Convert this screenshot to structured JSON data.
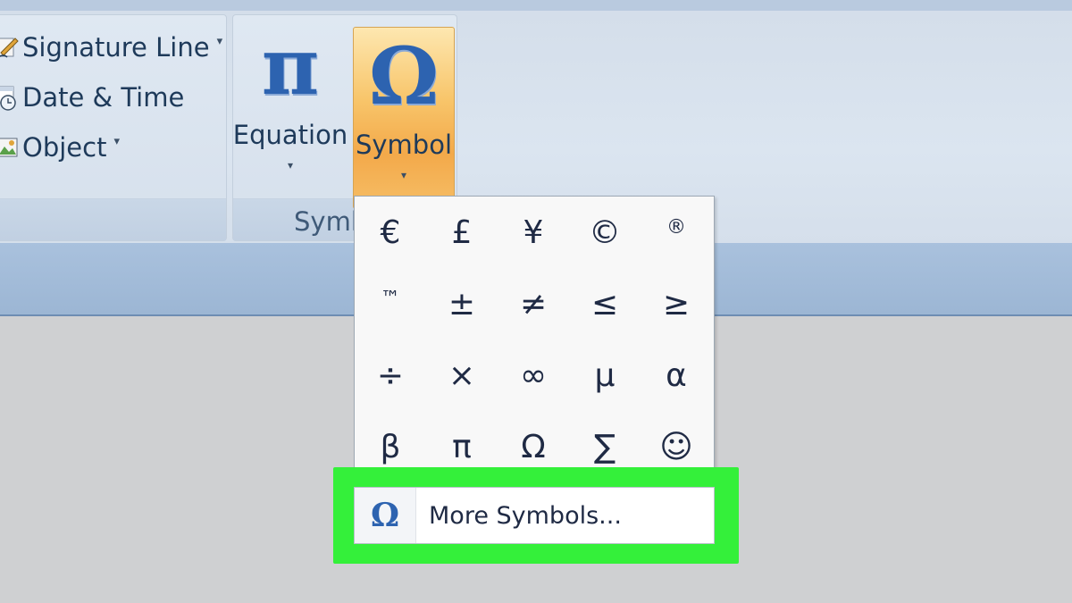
{
  "insert_text_group": {
    "items": [
      {
        "label": "Signature Line",
        "icon": "signature-line-icon",
        "has_dropdown": true
      },
      {
        "label": "Date & Time",
        "icon": "date-time-icon",
        "has_dropdown": false
      },
      {
        "label": "Object",
        "icon": "object-icon",
        "has_dropdown": true
      }
    ]
  },
  "symbols_group": {
    "label_visible": "Symb",
    "equation": {
      "label": "Equation",
      "glyph": "π"
    },
    "symbol": {
      "label": "Symbol",
      "glyph": "Ω",
      "state": "pressed"
    }
  },
  "symbol_menu": {
    "symbols": [
      "€",
      "£",
      "¥",
      "©",
      "®",
      "™",
      "±",
      "≠",
      "≤",
      "≥",
      "÷",
      "×",
      "∞",
      "µ",
      "α",
      "β",
      "π",
      "Ω",
      "∑",
      "☺"
    ],
    "more_symbols": {
      "label": "More Symbols...",
      "accesskey": "M",
      "icon_glyph": "Ω"
    }
  },
  "highlight_color": "#34f03a",
  "accent_color": "#2d63b0",
  "symbol_button_color": "#f6b85a"
}
